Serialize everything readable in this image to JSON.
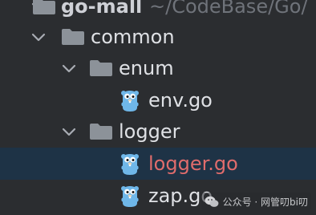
{
  "tree": {
    "root": {
      "name": "go-mall",
      "path": "~/CodeBase/Go/",
      "icon": "folder-icon",
      "expanded": true
    },
    "nodes": [
      {
        "name": "common",
        "type": "folder",
        "icon": "folder-icon",
        "expanded": true
      },
      {
        "name": "enum",
        "type": "folder",
        "icon": "folder-icon",
        "expanded": true
      },
      {
        "name": "env.go",
        "type": "file",
        "icon": "gopher-icon"
      },
      {
        "name": "logger",
        "type": "folder",
        "icon": "folder-icon",
        "expanded": true
      },
      {
        "name": "logger.go",
        "type": "file",
        "icon": "gopher-icon",
        "selected": true,
        "has_error": true
      },
      {
        "name": "zap.go",
        "type": "file",
        "icon": "gopher-icon"
      }
    ]
  },
  "colors": {
    "background": "#2b2d30",
    "selection": "#1e3346",
    "text": "#dfe1e5",
    "path_text": "#6f737a",
    "error_text": "#e06c6c",
    "folder": "#8c9299",
    "gopher": "#6fb7e9"
  },
  "watermark": {
    "label": "公众号 · 网管叨bi叨",
    "icon": "wechat-icon"
  }
}
